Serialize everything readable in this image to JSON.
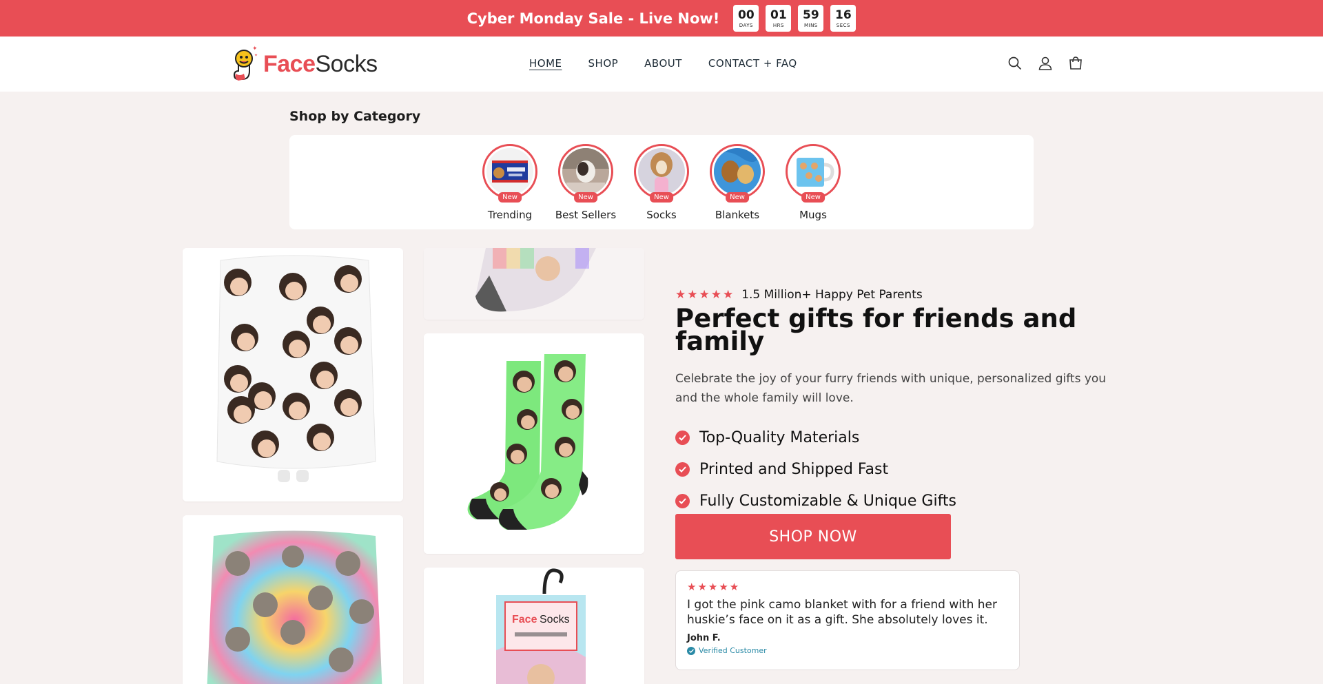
{
  "announcement": {
    "text": "Cyber Monday Sale - Live Now!",
    "countdown": [
      {
        "value": "00",
        "label": "DAYS"
      },
      {
        "value": "01",
        "label": "HRS"
      },
      {
        "value": "59",
        "label": "MINS"
      },
      {
        "value": "16",
        "label": "SECS"
      }
    ]
  },
  "header": {
    "logo": {
      "face": "Face",
      "socks": "Socks"
    },
    "nav": [
      {
        "label": "HOME",
        "active": true
      },
      {
        "label": "SHOP"
      },
      {
        "label": "ABOUT"
      },
      {
        "label": "CONTACT + FAQ"
      }
    ],
    "icons": [
      "search-icon",
      "account-icon",
      "cart-icon"
    ]
  },
  "categories": {
    "title": "Shop by Category",
    "items": [
      {
        "label": "Trending",
        "badge": "New"
      },
      {
        "label": "Best Sellers",
        "badge": "New"
      },
      {
        "label": "Socks",
        "badge": "New"
      },
      {
        "label": "Blankets",
        "badge": "New"
      },
      {
        "label": "Mugs",
        "badge": "New"
      }
    ]
  },
  "hero": {
    "rating_text": "1.5 Million+ Happy Pet Parents",
    "stars": "★★★★★",
    "title": "Perfect gifts for friends and family",
    "subtitle": "Celebrate the joy of your furry friends with unique, personalized gifts you and the whole family will love.",
    "features": [
      "Top-Quality Materials",
      "Printed and Shipped Fast",
      "Fully Customizable & Unique Gifts"
    ],
    "cta": "SHOP NOW"
  },
  "review": {
    "stars": "★★★★★",
    "text": "I got the pink camo blanket with for a friend with her huskie’s face on it as a gift. She absolutely loves it.",
    "author": "John F.",
    "verified": "Verified Customer"
  },
  "colors": {
    "accent": "#e84e55",
    "background": "#f6f1f0",
    "verified": "#2a8aa6"
  }
}
